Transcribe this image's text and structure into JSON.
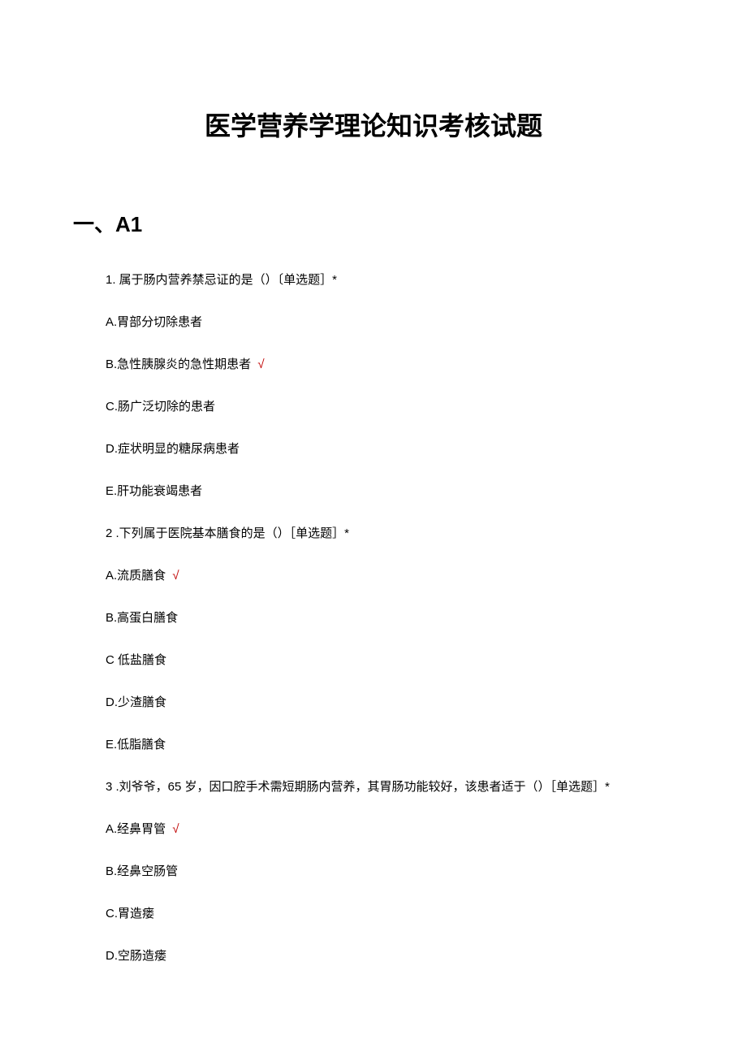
{
  "title": "医学营养学理论知识考核试题",
  "sectionHeading": "一、A1",
  "checkMark": "√",
  "questions": [
    {
      "num": "1.",
      "text": " 属于肠内营养禁忌证的是（）〔单选题］*",
      "options": [
        {
          "label": "A.胃部分切除患者",
          "correct": false
        },
        {
          "label": "B.急性胰腺炎的急性期患者 ",
          "correct": true
        },
        {
          "label": "C.肠广泛切除的患者",
          "correct": false
        },
        {
          "label": "D.症状明显的糖尿病患者",
          "correct": false
        },
        {
          "label": "E.肝功能衰竭患者",
          "correct": false
        }
      ]
    },
    {
      "num": "2",
      "text": "  .下列属于医院基本膳食的是（）［单选题］*",
      "options": [
        {
          "label": "A.流质膳食 ",
          "correct": true
        },
        {
          "label": "B.高蛋白膳食",
          "correct": false
        },
        {
          "label": "C 低盐膳食",
          "correct": false
        },
        {
          "label": "D.少渣膳食",
          "correct": false
        },
        {
          "label": "E.低脂膳食",
          "correct": false
        }
      ]
    },
    {
      "num": "3",
      "text": "  .刘爷爷，65 岁，因口腔手术需短期肠内营养，其胃肠功能较好，该患者适于（）［单选题］*",
      "options": [
        {
          "label": "A.经鼻胃管 ",
          "correct": true
        },
        {
          "label": "B.经鼻空肠管",
          "correct": false
        },
        {
          "label": "C.胃造瘘",
          "correct": false
        },
        {
          "label": "D.空肠造瘘",
          "correct": false
        }
      ]
    }
  ]
}
